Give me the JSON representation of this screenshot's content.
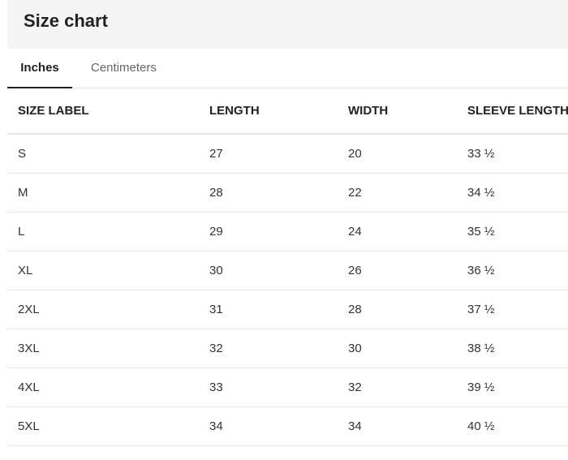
{
  "header": {
    "title": "Size chart"
  },
  "tabs": [
    {
      "label": "Inches",
      "active": true
    },
    {
      "label": "Centimeters",
      "active": false
    }
  ],
  "table": {
    "columns": [
      "SIZE LABEL",
      "LENGTH",
      "WIDTH",
      "SLEEVE LENGTH"
    ],
    "rows": [
      [
        "S",
        "27",
        "20",
        "33 ½"
      ],
      [
        "M",
        "28",
        "22",
        "34 ½"
      ],
      [
        "L",
        "29",
        "24",
        "35 ½"
      ],
      [
        "XL",
        "30",
        "26",
        "36 ½"
      ],
      [
        "2XL",
        "31",
        "28",
        "37 ½"
      ],
      [
        "3XL",
        "32",
        "30",
        "38 ½"
      ],
      [
        "4XL",
        "33",
        "32",
        "39 ½"
      ],
      [
        "5XL",
        "34",
        "34",
        "40 ½"
      ]
    ]
  }
}
